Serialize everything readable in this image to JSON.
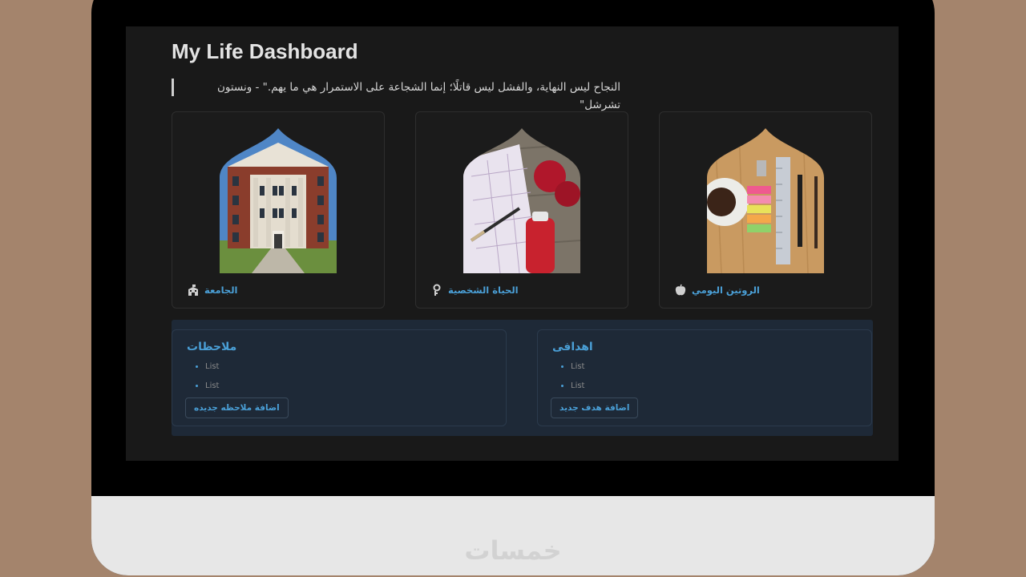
{
  "page": {
    "title": "My Life Dashboard",
    "quote": "النجاح ليس النهاية، والفشل ليس قاتلًا؛ إنما الشجاعة على الاستمرار هي ما يهم.\" - ونستون تشرشل\""
  },
  "cards": [
    {
      "label": "الجامعة",
      "icon": "school-icon"
    },
    {
      "label": "الحياة الشخصية",
      "icon": "person-icon"
    },
    {
      "label": "الروتين اليومي",
      "icon": "apple-icon"
    }
  ],
  "notes_panel": {
    "heading": "ملاحظات",
    "items": [
      "List",
      "List"
    ],
    "add_button": "اضافة ملاحظه جديده"
  },
  "goals_panel": {
    "heading": "اهدافى",
    "items": [
      "List",
      "List"
    ],
    "add_button": "اضافة هدف جديد"
  },
  "brand": {
    "logo_text": "خمسات"
  },
  "colors": {
    "accent": "#4a9fd6",
    "page_background": "#191919",
    "panel_background": "#1e2937",
    "backdrop": "#a4846c"
  }
}
